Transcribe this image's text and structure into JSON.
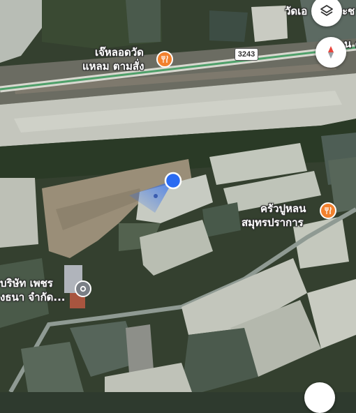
{
  "map": {
    "road_shield": "3243",
    "places": {
      "temple_top": "วัดเอ",
      "top_right_fragment_1": "ะช",
      "top_right_fragment_2": "น ค",
      "restaurant_1_line1": "เจ๊หลอดวัด",
      "restaurant_1_line2": "แหลม ตามสั่ง",
      "restaurant_2_line1": "ครัวปูหลน",
      "restaurant_2_line2": "สมุทรปราการ",
      "company_line1": "บริษัท เพชร",
      "company_line2": "งธนา จำกัด..."
    }
  },
  "controls": {
    "layers_icon": "layers-icon",
    "compass_icon": "compass-icon"
  },
  "colors": {
    "restaurant_pin": "#f2812e",
    "place_pin": "#7a7f86",
    "location_dot": "#2a6bf2",
    "road": "#8f9a93",
    "highway_line": "#4fa06a"
  }
}
